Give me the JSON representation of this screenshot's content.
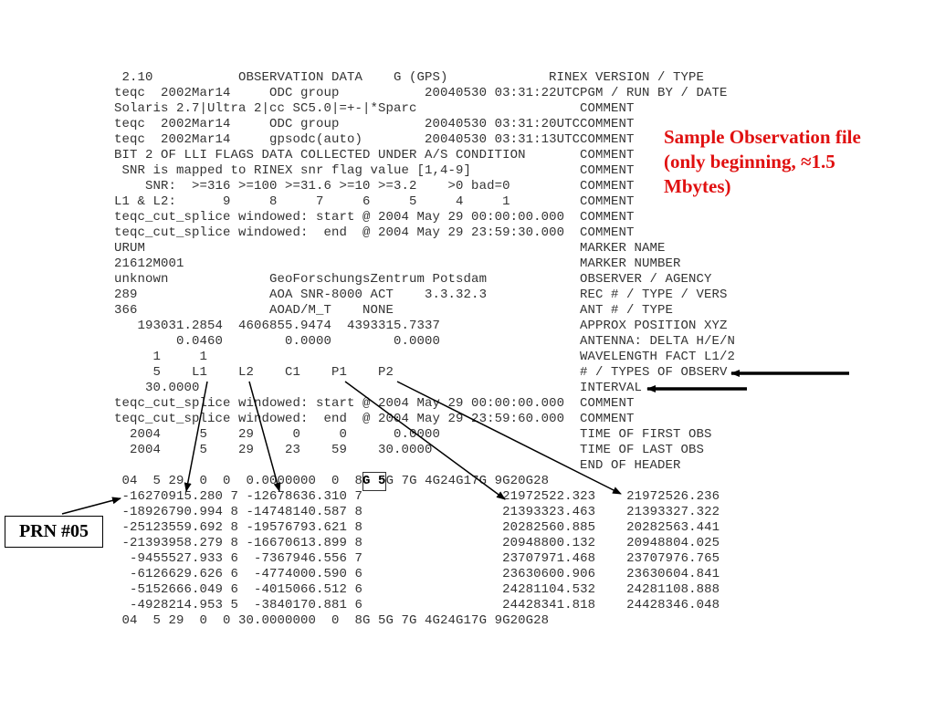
{
  "header": [
    {
      "content": " 2.10           OBSERVATION DATA    G (GPS)",
      "label": "RINEX VERSION / TYPE"
    },
    {
      "content": "teqc  2002Mar14     ODC group           20040530 03:31:22UTC",
      "label": "PGM / RUN BY / DATE"
    },
    {
      "content": "Solaris 2.7|Ultra 2|cc SC5.0|=+-|*Sparc",
      "label": "COMMENT"
    },
    {
      "content": "teqc  2002Mar14     ODC group           20040530 03:31:20UTC",
      "label": "COMMENT"
    },
    {
      "content": "teqc  2002Mar14     gpsodc(auto)        20040530 03:31:13UTC",
      "label": "COMMENT"
    },
    {
      "content": "BIT 2 OF LLI FLAGS DATA COLLECTED UNDER A/S CONDITION",
      "label": "COMMENT"
    },
    {
      "content": " SNR is mapped to RINEX snr flag value [1,4-9]",
      "label": "COMMENT"
    },
    {
      "content": "    SNR:  >=316 >=100 >=31.6 >=10 >=3.2    >0 bad=0",
      "label": "COMMENT"
    },
    {
      "content": "L1 & L2:      9     8     7     6     5     4     1",
      "label": "COMMENT"
    },
    {
      "content": "teqc_cut_splice windowed: start @ 2004 May 29 00:00:00.000",
      "label": "COMMENT"
    },
    {
      "content": "teqc_cut_splice windowed:  end  @ 2004 May 29 23:59:30.000",
      "label": "COMMENT"
    },
    {
      "content": "URUM",
      "label": "MARKER NAME"
    },
    {
      "content": "21612M001",
      "label": "MARKER NUMBER"
    },
    {
      "content": "unknown             GeoForschungsZentrum Potsdam",
      "label": "OBSERVER / AGENCY"
    },
    {
      "content": "289                 AOA SNR-8000 ACT    3.3.32.3",
      "label": "REC # / TYPE / VERS"
    },
    {
      "content": "366                 AOAD/M_T    NONE",
      "label": "ANT # / TYPE"
    },
    {
      "content": "   193031.2854  4606855.9474  4393315.7337",
      "label": "APPROX POSITION XYZ"
    },
    {
      "content": "        0.0460        0.0000        0.0000",
      "label": "ANTENNA: DELTA H/E/N"
    },
    {
      "content": "     1     1",
      "label": "WAVELENGTH FACT L1/2"
    },
    {
      "content": "     5    L1    L2    C1    P1    P2",
      "label": "# / TYPES OF OBSERV"
    },
    {
      "content": "    30.0000",
      "label": "INTERVAL"
    },
    {
      "content": "teqc_cut_splice windowed: start @ 2004 May 29 00:00:00.000",
      "label": "COMMENT"
    },
    {
      "content": "teqc_cut_splice windowed:  end  @ 2004 May 29 23:59:60.000",
      "label": "COMMENT"
    },
    {
      "content": "  2004     5    29     0     0      0.0000",
      "label": "TIME OF FIRST OBS"
    },
    {
      "content": "  2004     5    29    23    59    30.0000",
      "label": "TIME OF LAST OBS"
    },
    {
      "content": "",
      "label": "END OF HEADER"
    }
  ],
  "epoch1": {
    "pre": " 04  5 29  0  0  0.0000000  0  8",
    "highlight": "G 5",
    "post": "G 7G 4G24G17G 9G20G28"
  },
  "observations": [
    " -16270915.280 7 -12678636.310 7                  21972522.323    21972526.236",
    " -18926790.994 8 -14748140.587 8                  21393323.463    21393327.322",
    " -25123559.692 8 -19576793.621 8                  20282560.885    20282563.441",
    " -21393958.279 8 -16670613.899 8                  20948800.132    20948804.025",
    "  -9455527.933 6  -7367946.556 7                  23707971.468    23707976.765",
    "  -6126629.626 6  -4774000.590 6                  23630600.906    23630604.841",
    "  -5152666.049 6  -4015066.512 6                  24281104.532    24281108.888",
    "  -4928214.953 5  -3840170.881 6                  24428341.818    24428346.048"
  ],
  "epoch2": " 04  5 29  0  0 30.0000000  0  8G 5G 7G 4G24G17G 9G20G28",
  "annotation": {
    "line1": "Sample Observation file",
    "line2": "(only beginning, ≈1.5",
    "line3": "Mbytes)",
    "color": "#e01010"
  },
  "prn_label": "PRN #05"
}
